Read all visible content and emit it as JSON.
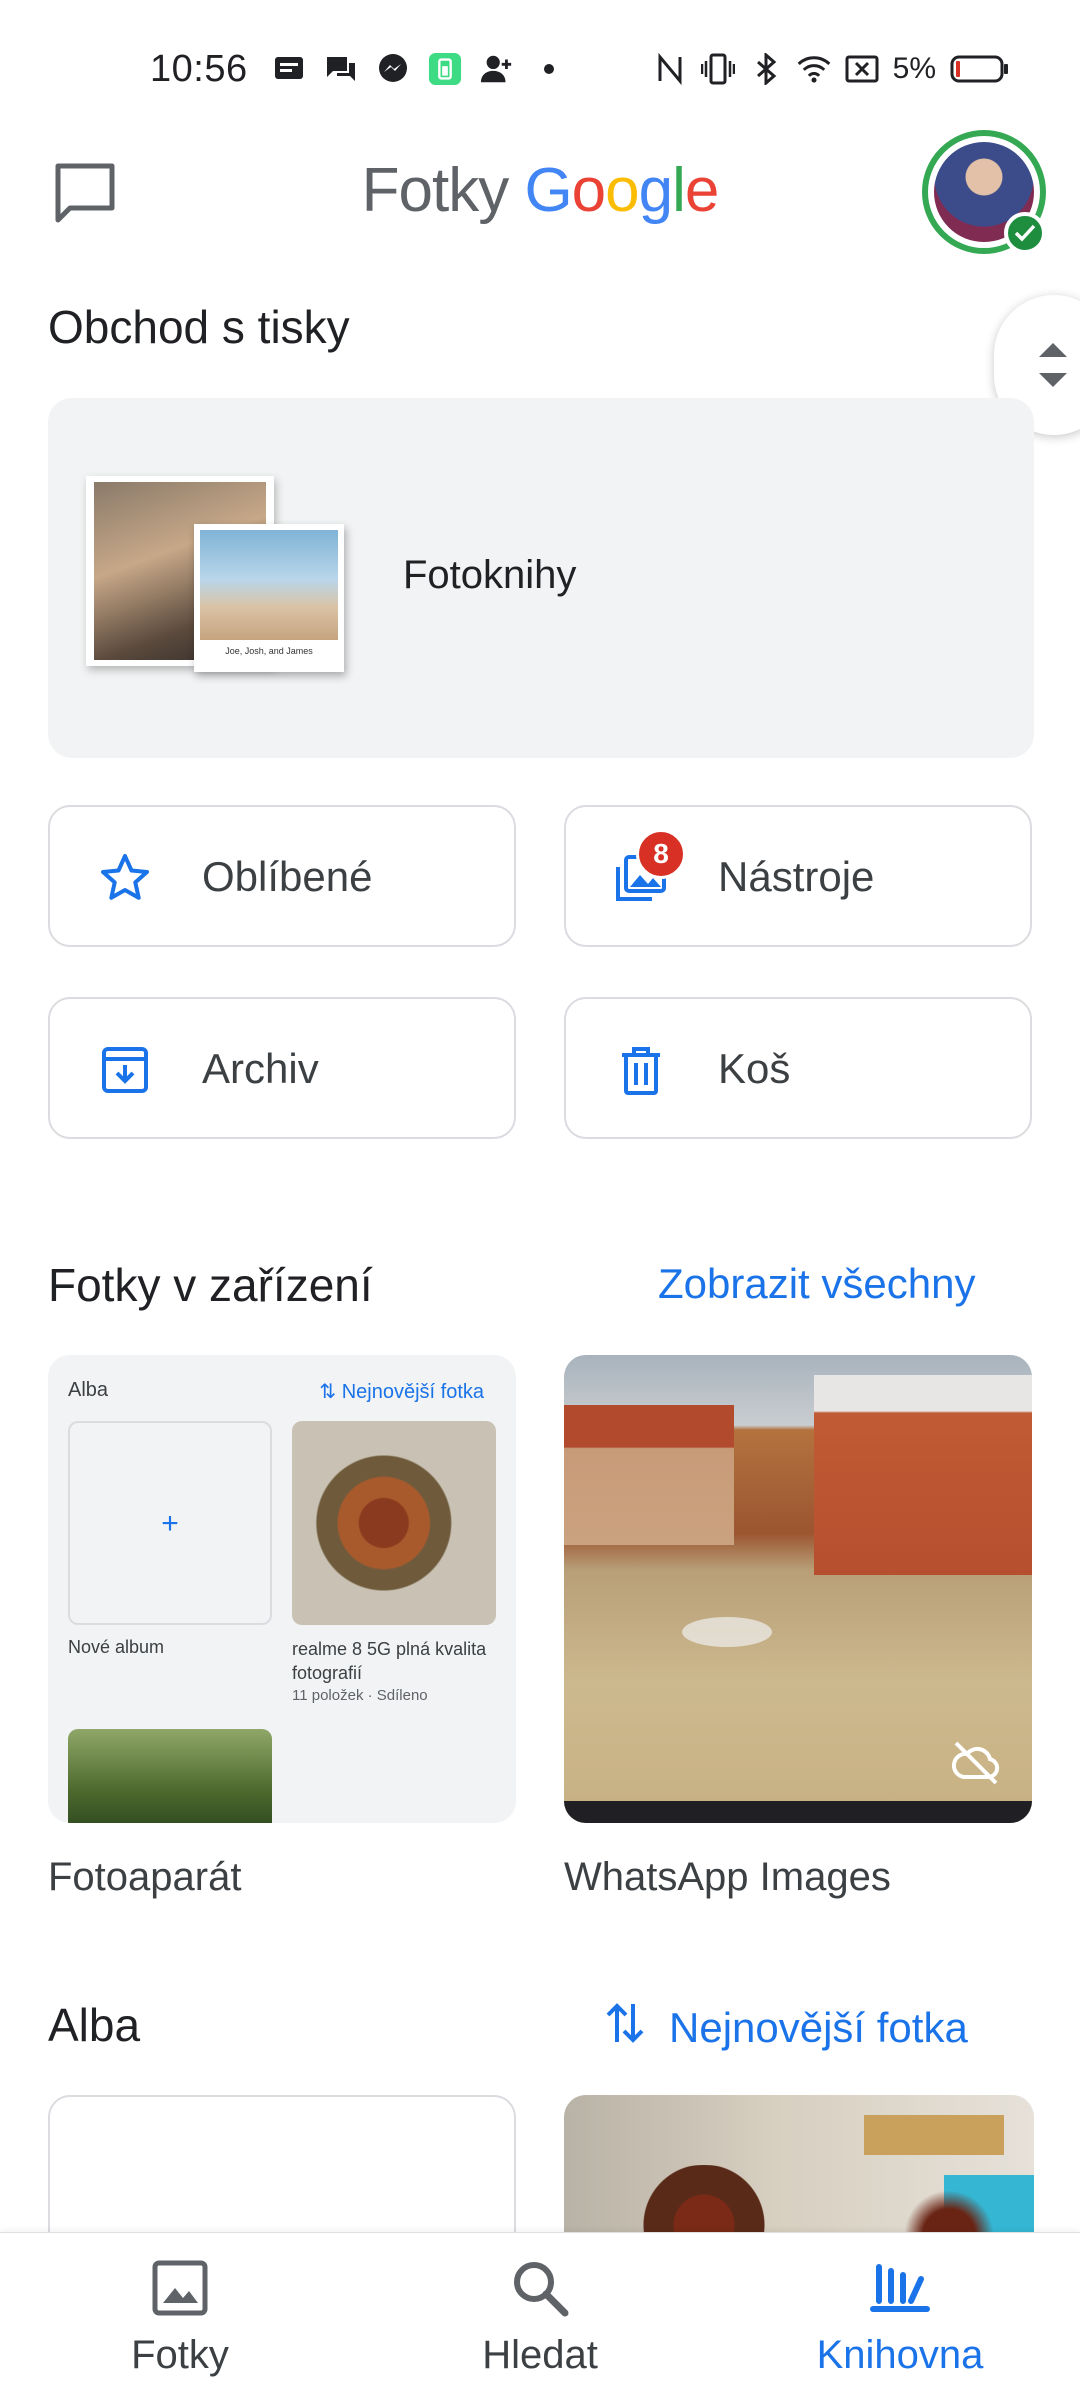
{
  "status_bar": {
    "time": "10:56",
    "battery_percent": "5%",
    "left_icons": [
      "message-icon",
      "chat-icon",
      "messenger-icon",
      "battery-app-icon",
      "add-person-icon",
      "dot-icon"
    ],
    "right_icons": [
      "nfc-icon",
      "vibrate-icon",
      "bluetooth-icon",
      "wifi-icon",
      "no-sim-icon",
      "battery-icon"
    ]
  },
  "appbar": {
    "logo_prefix": "Fotky",
    "logo_brand": [
      "G",
      "o",
      "o",
      "g",
      "l",
      "e"
    ]
  },
  "print_store": {
    "title": "Obchod s tisky",
    "card_label": "Fotoknihy",
    "book_caption": "Joe, Josh, and James"
  },
  "tiles": [
    {
      "label": "Oblíbené",
      "icon": "star-icon"
    },
    {
      "label": "Nástroje",
      "icon": "tools-icon",
      "badge": "8"
    },
    {
      "label": "Archiv",
      "icon": "archive-icon"
    },
    {
      "label": "Koš",
      "icon": "trash-icon"
    }
  ],
  "device_photos": {
    "title": "Fotky v zařízení",
    "link": "Zobrazit všechny",
    "folders": [
      {
        "label": "Fotoaparát",
        "preview": {
          "title": "Alba",
          "link": "Nejnovější fotka",
          "new_album": "Nové album",
          "plus": "+",
          "album_name": "realme 8 5G plná kvalita fotografií",
          "album_meta": "11 položek · Sdíleno"
        }
      },
      {
        "label": "WhatsApp Images"
      }
    ]
  },
  "albums": {
    "title": "Alba",
    "sort_link": "Nejnovější fotka"
  },
  "bottom_nav": [
    {
      "label": "Fotky",
      "icon": "photo-icon",
      "active": false
    },
    {
      "label": "Hledat",
      "icon": "search-icon",
      "active": false
    },
    {
      "label": "Knihovna",
      "icon": "library-icon",
      "active": true
    }
  ],
  "colors": {
    "accent": "#1a73e8",
    "badge": "#d93025",
    "avatar_ring": "#34a853",
    "card_bg": "#f1f3f4"
  }
}
